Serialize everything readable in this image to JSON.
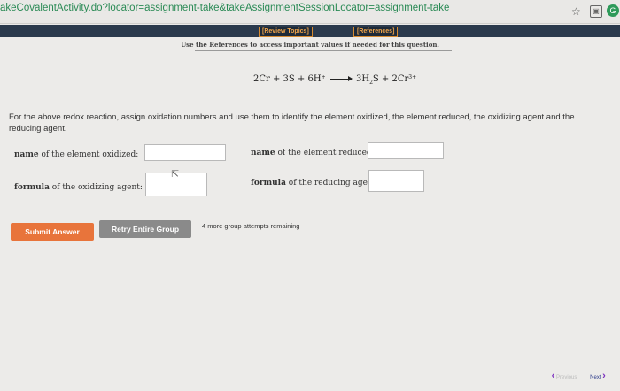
{
  "browser": {
    "url": "akeCovalentActivity.do?locator=assignment-take&takeAssignmentSessionLocator=assignment-take"
  },
  "header": {
    "review_topics": "[Review Topics]",
    "references": "[References]",
    "notice": "Use the References to access important values if needed for this question."
  },
  "question": {
    "equation": {
      "lhs_1": "2Cr + 3S + 6H",
      "lhs_1_sup": "+",
      "rhs_1": "3H",
      "rhs_1_sub": "2",
      "rhs_2": "S + 2Cr",
      "rhs_2_sup": "3+"
    },
    "instructions": "For the above redox reaction, assign oxidation numbers and use them to identify the element oxidized, the element reduced, the oxidizing agent and the reducing agent.",
    "fields": {
      "oxidized_bold": "name",
      "oxidized_rest": " of the element oxidized:",
      "reduced_bold": "name",
      "reduced_rest": " of the element reduced:",
      "oxidizing_bold": "formula",
      "oxidizing_rest": " of the oxidizing agent:",
      "reducing_bold": "formula",
      "reducing_rest": " of the reducing agent:"
    }
  },
  "actions": {
    "submit": "Submit Answer",
    "retry": "Retry Entire Group",
    "attempts": "4 more group attempts remaining"
  },
  "nav": {
    "previous": "Previous",
    "next": "Next"
  },
  "colors": {
    "submit_bg": "#e8743b",
    "retry_bg": "#8a8a8a",
    "header_bg": "#2b3a4d",
    "accent_orange": "#f0a44a"
  }
}
